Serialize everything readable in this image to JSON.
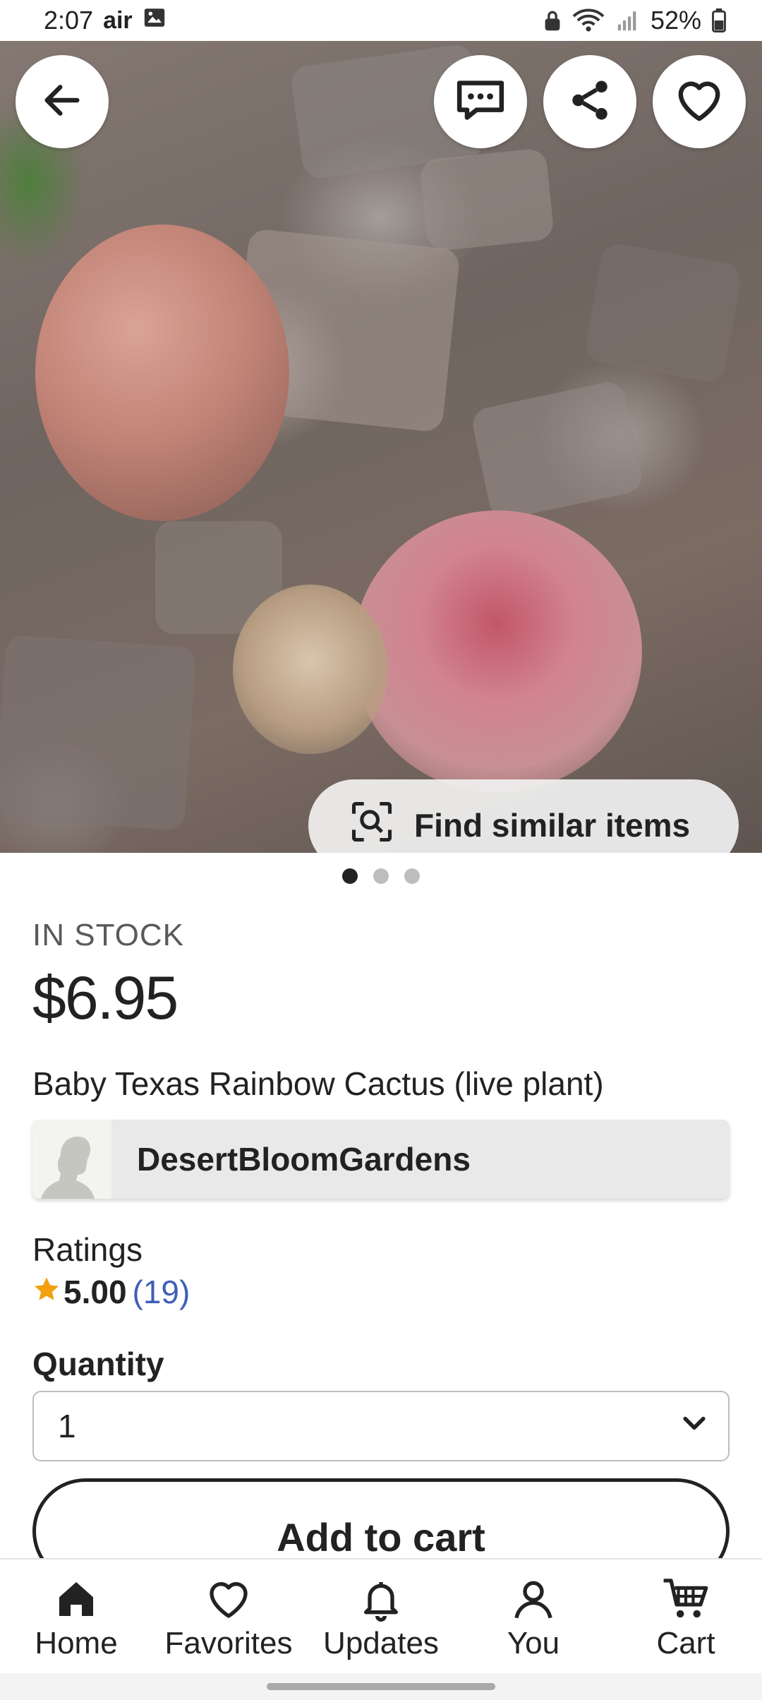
{
  "status_bar": {
    "time": "2:07",
    "carrier_glyph": "air",
    "battery": "52%"
  },
  "hero": {
    "find_similar_label": "Find similar items",
    "page_count": 3,
    "active_page": 1
  },
  "product": {
    "stock_status": "IN STOCK",
    "price": "$6.95",
    "title": "Baby Texas Rainbow Cactus (live plant)"
  },
  "shop": {
    "name": "DesertBloomGardens"
  },
  "ratings": {
    "label": "Ratings",
    "value": "5.00",
    "count": "(19)",
    "star_color": "#f1a10d"
  },
  "quantity": {
    "label": "Quantity",
    "selected": "1"
  },
  "actions": {
    "add_to_cart": "Add to cart"
  },
  "bottom_nav": {
    "items": [
      {
        "label": "Home",
        "icon": "home-icon",
        "active": true
      },
      {
        "label": "Favorites",
        "icon": "heart-icon"
      },
      {
        "label": "Updates",
        "icon": "bell-icon"
      },
      {
        "label": "You",
        "icon": "person-icon"
      },
      {
        "label": "Cart",
        "icon": "cart-icon"
      }
    ]
  },
  "colors": {
    "text": "#222222",
    "link": "#3f5fb7",
    "card_bg": "#e9e9e9"
  }
}
